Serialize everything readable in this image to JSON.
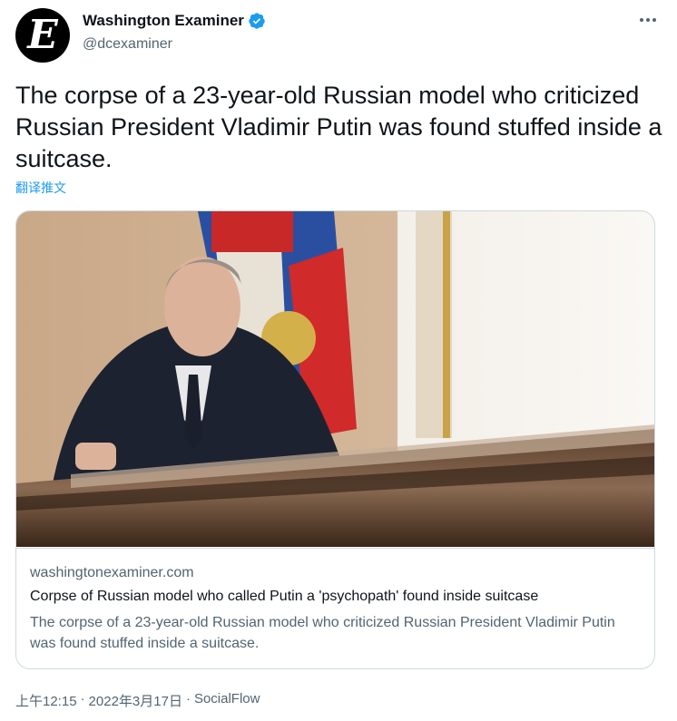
{
  "account": {
    "name": "Washington Examiner",
    "handle": "@dcexaminer",
    "avatar_letter": "E"
  },
  "tweet": {
    "text": "The corpse of a 23-year-old Russian model who criticized Russian President Vladimir Putin was found stuffed inside a suitcase.",
    "translate_label": "翻译推文"
  },
  "card": {
    "domain": "washingtonexaminer.com",
    "headline": "Corpse of Russian model who called Putin a 'psychopath' found inside suitcase",
    "description": "The corpse of a 23-year-old Russian model who criticized Russian President Vladimir Putin was found stuffed inside a suitcase."
  },
  "meta": {
    "time": "上午12:15",
    "separator1": "·",
    "date": "2022年3月17日",
    "separator2": "·",
    "source": "SocialFlow"
  },
  "colors": {
    "verified": "#1d9bf0",
    "link": "#1d9bf0",
    "secondary_text": "#536471"
  }
}
